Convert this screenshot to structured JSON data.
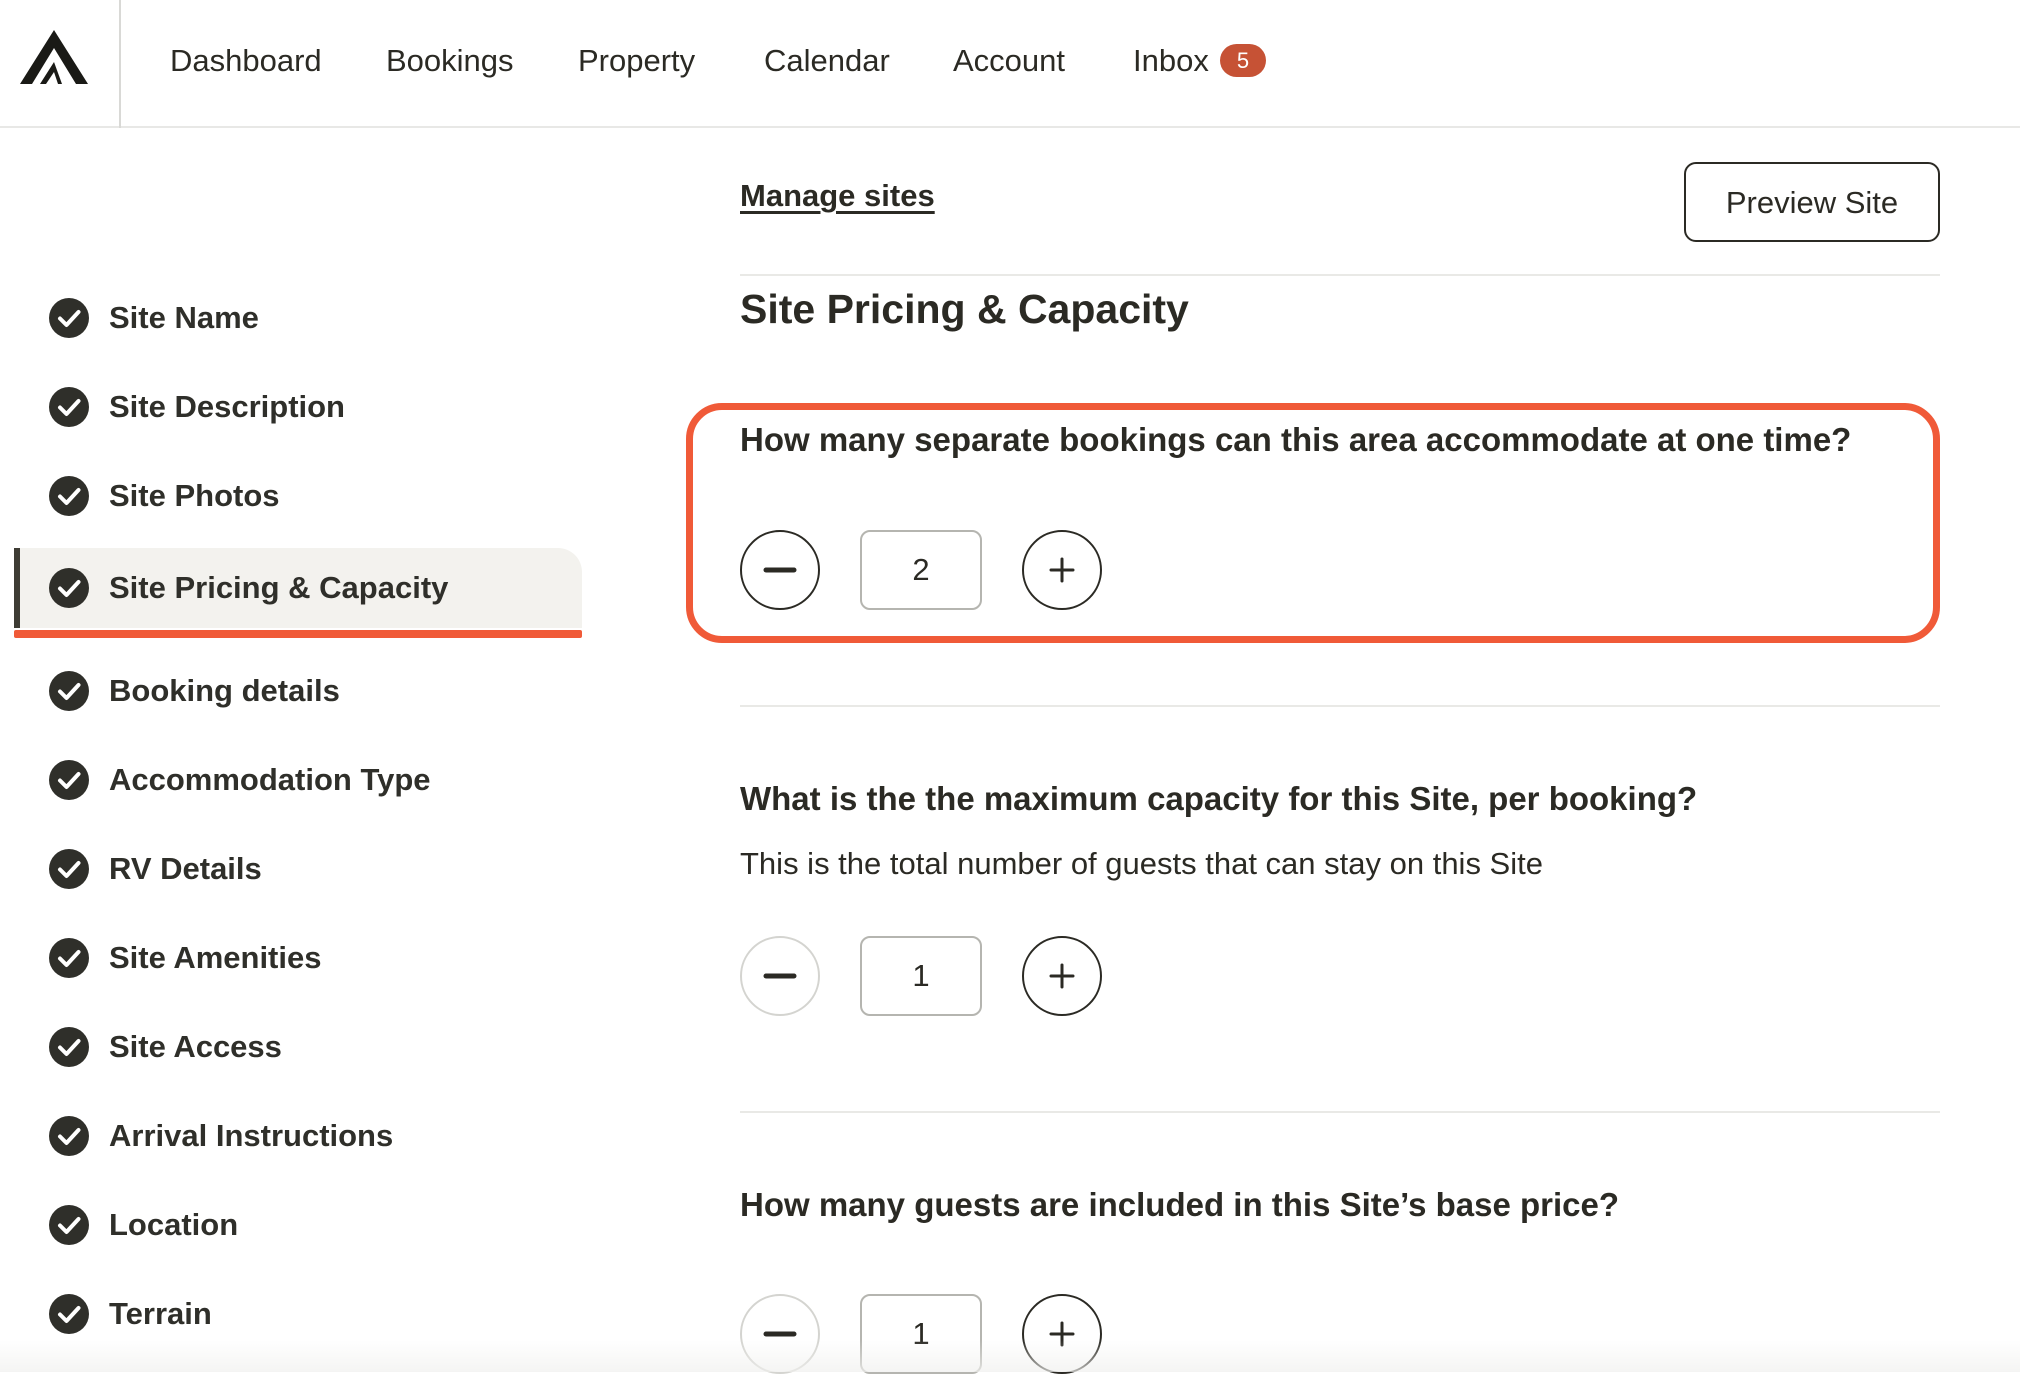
{
  "nav": {
    "items": [
      {
        "label": "Dashboard"
      },
      {
        "label": "Bookings"
      },
      {
        "label": "Property"
      },
      {
        "label": "Calendar"
      },
      {
        "label": "Account"
      },
      {
        "label": "Inbox"
      }
    ],
    "inbox_count": "5"
  },
  "sidebar": {
    "items": [
      {
        "label": "Site Name",
        "complete": true
      },
      {
        "label": "Site Description",
        "complete": true
      },
      {
        "label": "Site Photos",
        "complete": true
      },
      {
        "label": "Site Pricing & Capacity",
        "complete": true,
        "active": true
      },
      {
        "label": "Booking details",
        "complete": true
      },
      {
        "label": "Accommodation Type",
        "complete": true
      },
      {
        "label": "RV Details",
        "complete": true
      },
      {
        "label": "Site Amenities",
        "complete": true
      },
      {
        "label": "Site Access",
        "complete": true
      },
      {
        "label": "Arrival Instructions",
        "complete": true
      },
      {
        "label": "Location",
        "complete": true
      },
      {
        "label": "Terrain",
        "complete": true
      }
    ]
  },
  "main": {
    "manage_link": "Manage sites",
    "preview_button": "Preview Site",
    "section_title": "Site Pricing & Capacity",
    "questions": [
      {
        "title": "How many separate bookings can this area accommodate at one time?",
        "help": "",
        "value": "2"
      },
      {
        "title": "What is the the maximum capacity for this Site, per booking?",
        "help": "This is the total number of guests that can stay on this Site",
        "value": "1"
      },
      {
        "title": "How many guests are included in this Site’s base price?",
        "help": "",
        "value": "1"
      }
    ]
  },
  "colors": {
    "highlight": "#f05a38",
    "badge": "#c65235",
    "text": "#2b2a24"
  }
}
